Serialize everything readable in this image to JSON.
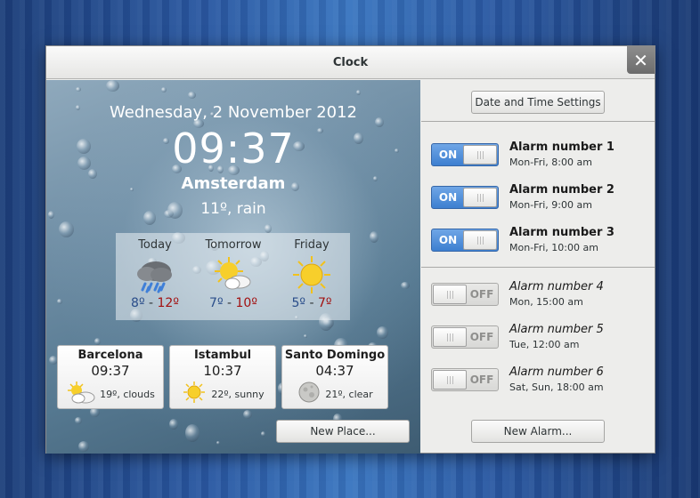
{
  "window": {
    "title": "Clock",
    "close_glyph": "✕"
  },
  "main_clock": {
    "date": "Wednesday, 2 November 2012",
    "time": "09:37",
    "city": "Amsterdam",
    "condition": "11º, rain"
  },
  "forecast": [
    {
      "day": "Today",
      "icon": "rain-cloud-icon",
      "low": "8º",
      "sep": " - ",
      "high": "12º"
    },
    {
      "day": "Tomorrow",
      "icon": "sun-cloud-icon",
      "low": "7º",
      "sep": " - ",
      "high": "10º"
    },
    {
      "day": "Friday",
      "icon": "sun-icon",
      "low": "5º",
      "sep": " - ",
      "high": "7º"
    }
  ],
  "places": [
    {
      "city": "Barcelona",
      "time": "09:37",
      "icon": "sun-cloud-icon",
      "condition": "19º, clouds"
    },
    {
      "city": "Istambul",
      "time": "10:37",
      "icon": "sun-icon",
      "condition": "22º, sunny"
    },
    {
      "city": "Santo Domingo",
      "time": "04:37",
      "icon": "moon-icon",
      "condition": "21º, clear"
    }
  ],
  "buttons": {
    "new_place": "New Place...",
    "date_time_settings": "Date and Time Settings",
    "new_alarm": "New Alarm..."
  },
  "alarms": [
    {
      "name": "Alarm number 1",
      "schedule": "Mon-Fri, 8:00 am",
      "state": "ON",
      "enabled": true
    },
    {
      "name": "Alarm number 2",
      "schedule": "Mon-Fri, 9:00 am",
      "state": "ON",
      "enabled": true
    },
    {
      "name": "Alarm number 3",
      "schedule": "Mon-Fri, 10:00 am",
      "state": "ON",
      "enabled": true
    },
    {
      "name": "Alarm number 4",
      "schedule": "Mon, 15:00 am",
      "state": "OFF",
      "enabled": false
    },
    {
      "name": "Alarm number 5",
      "schedule": "Tue, 12:00 am",
      "state": "OFF",
      "enabled": false
    },
    {
      "name": "Alarm number 6",
      "schedule": "Sat, Sun, 18:00 am",
      "state": "OFF",
      "enabled": false
    }
  ],
  "colors": {
    "accent": "#3d7fd0",
    "temp_high": "#a21010",
    "temp_low": "#2a4d8a"
  }
}
